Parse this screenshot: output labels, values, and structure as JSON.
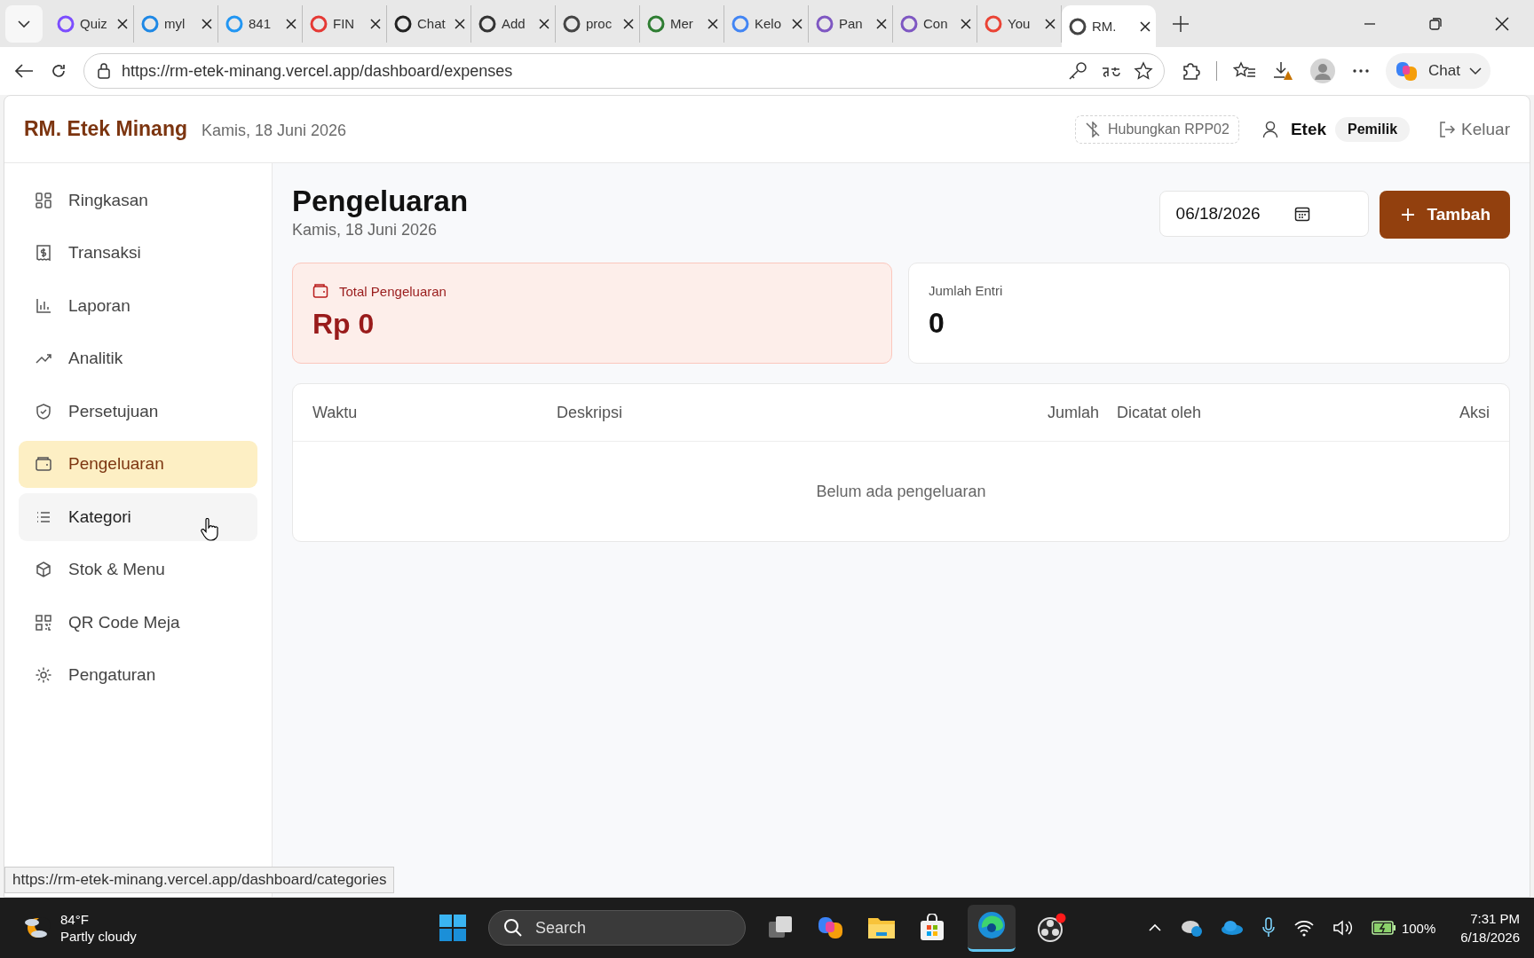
{
  "browser": {
    "tabs": [
      {
        "title": "Quiz",
        "selected": false
      },
      {
        "title": "myl",
        "selected": false
      },
      {
        "title": "841",
        "selected": false
      },
      {
        "title": "FIN",
        "selected": false
      },
      {
        "title": "Chat",
        "selected": false
      },
      {
        "title": "Add",
        "selected": false
      },
      {
        "title": "proc",
        "selected": false
      },
      {
        "title": "Mer",
        "selected": false
      },
      {
        "title": "Kelo",
        "selected": false
      },
      {
        "title": "Pan",
        "selected": false
      },
      {
        "title": "Con",
        "selected": false
      },
      {
        "title": "You",
        "selected": false
      },
      {
        "title": "RM.",
        "selected": true
      }
    ],
    "address": "https://rm-etek-minang.vercel.app/dashboard/expenses",
    "copilot_label": "Chat"
  },
  "app_header": {
    "brand": "RM. Etek Minang",
    "date": "Kamis, 18 Juni 2026",
    "printer_button": "Hubungkan RPP02",
    "user": "Etek",
    "role": "Pemilik",
    "logout": "Keluar"
  },
  "sidebar": {
    "items": [
      {
        "label": "Ringkasan",
        "selected": false,
        "hovered": false
      },
      {
        "label": "Transaksi",
        "selected": false,
        "hovered": false
      },
      {
        "label": "Laporan",
        "selected": false,
        "hovered": false
      },
      {
        "label": "Analitik",
        "selected": false,
        "hovered": false
      },
      {
        "label": "Persetujuan",
        "selected": false,
        "hovered": false
      },
      {
        "label": "Pengeluaran",
        "selected": true,
        "hovered": false
      },
      {
        "label": "Kategori",
        "selected": false,
        "hovered": true
      },
      {
        "label": "Stok & Menu",
        "selected": false,
        "hovered": false
      },
      {
        "label": "QR Code Meja",
        "selected": false,
        "hovered": false
      },
      {
        "label": "Pengaturan",
        "selected": false,
        "hovered": false
      }
    ]
  },
  "main": {
    "title": "Pengeluaran",
    "subtitle": "Kamis, 18 Juni 2026",
    "date_field": "06/18/2026",
    "add_button": "Tambah",
    "stats": [
      {
        "label": "Total Pengeluaran",
        "value": "Rp 0",
        "kind": "highlight"
      },
      {
        "label": "Jumlah Entri",
        "value": "0",
        "kind": "plain"
      }
    ],
    "table": {
      "columns": [
        "Waktu",
        "Deskripsi",
        "Jumlah",
        "Dicatat oleh",
        "Aksi"
      ],
      "empty_message": "Belum ada pengeluaran"
    }
  },
  "status_link": "https://rm-etek-minang.vercel.app/dashboard/categories",
  "taskbar": {
    "weather_temp": "84°F",
    "weather_text": "Partly cloudy",
    "search": "Search",
    "battery": "100%",
    "time": "7:31 PM",
    "date": "6/18/2026"
  }
}
